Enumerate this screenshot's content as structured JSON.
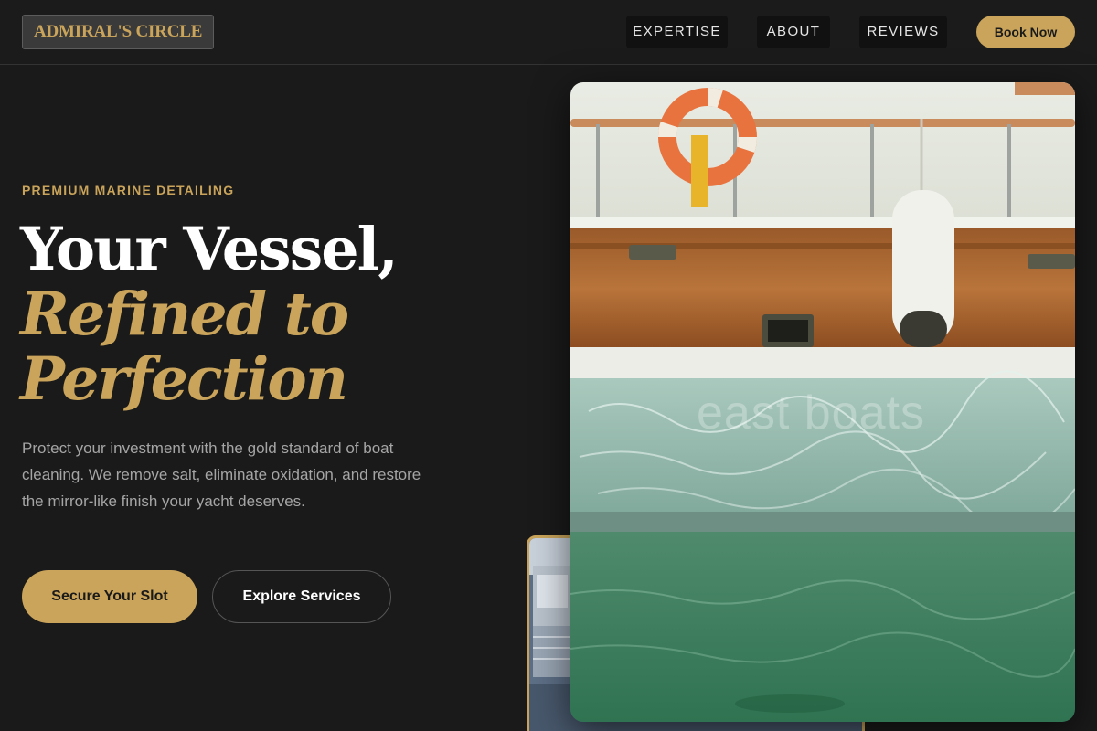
{
  "brand": {
    "logo": "ADMIRAL'S CIRCLE"
  },
  "nav": {
    "items": [
      {
        "label": "EXPERTISE"
      },
      {
        "label": "ABOUT"
      },
      {
        "label": "REVIEWS"
      }
    ],
    "cta": "Book Now"
  },
  "hero": {
    "eyebrow": "PREMIUM MARINE DETAILING",
    "headline_line1": "Your Vessel,",
    "headline_line2": "Refined to",
    "headline_line3": "Perfection",
    "subtext": "Protect your investment with the gold standard of boat cleaning. We remove salt, eliminate oxidation, and restore the mirror-like finish your yacht deserves.",
    "primary_cta": "Secure Your Slot",
    "secondary_cta": "Explore Services"
  },
  "photo": {
    "watermark": "east boats"
  },
  "colors": {
    "accent": "#c9a45a",
    "background": "#1a1a1a",
    "muted_text": "#a5a5a5"
  }
}
